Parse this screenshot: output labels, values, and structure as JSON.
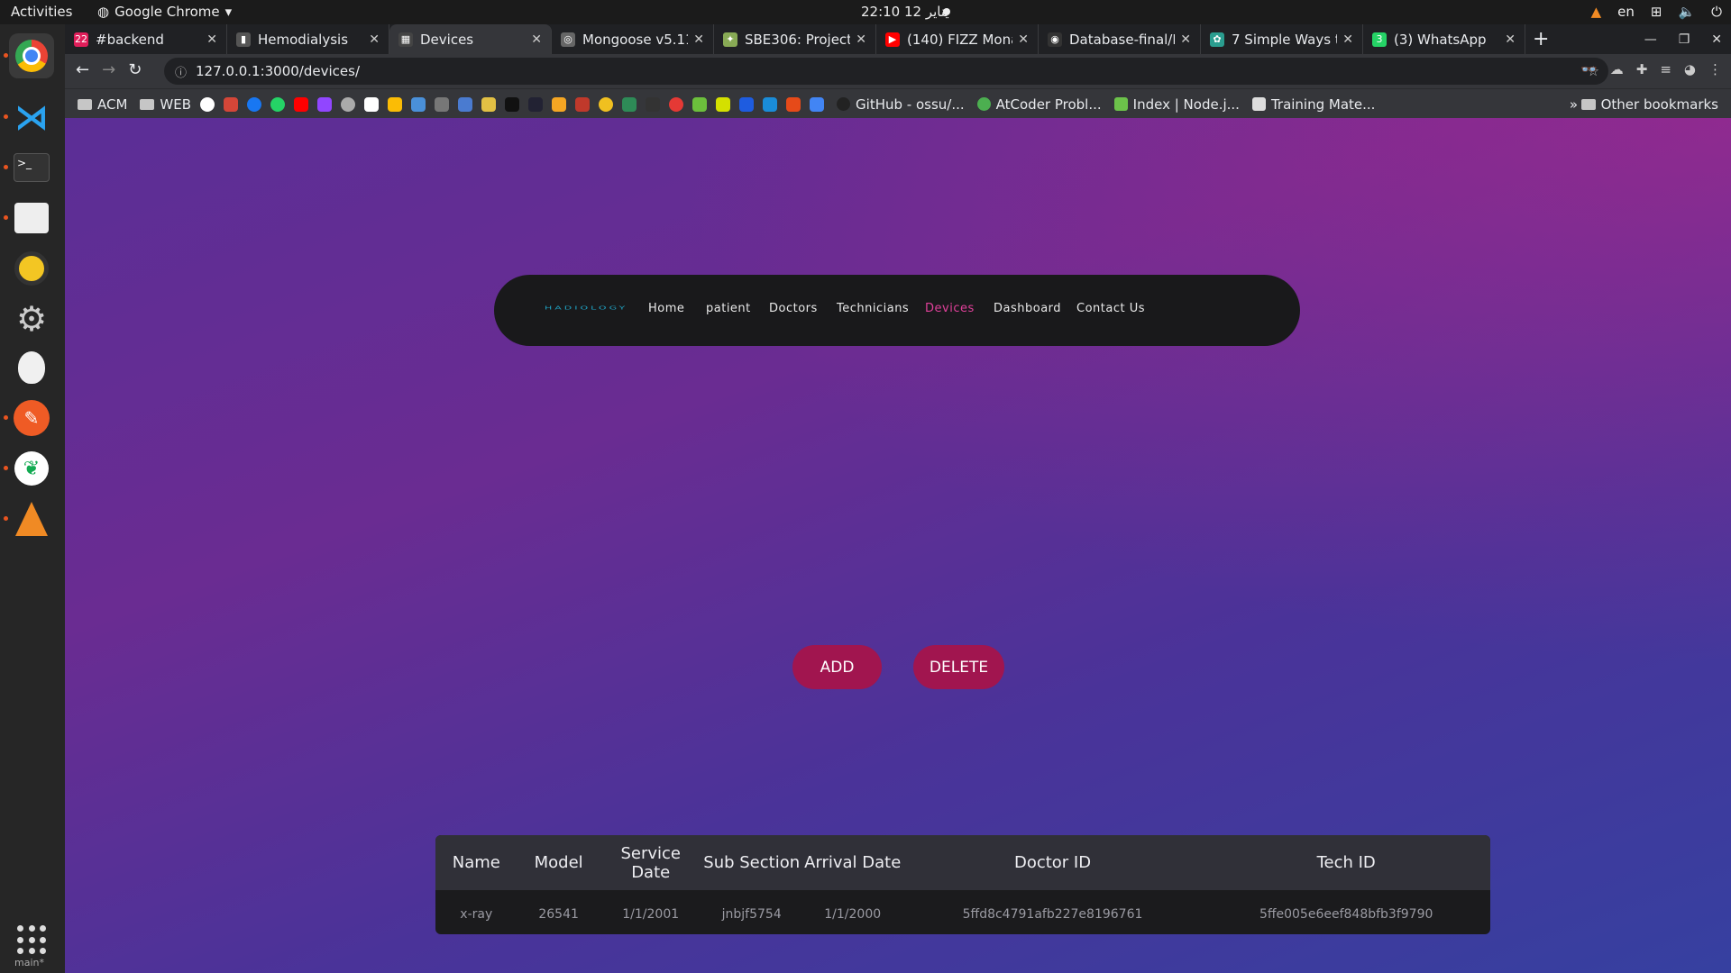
{
  "system": {
    "activities": "Activities",
    "app_name": "Google Chrome",
    "clock": "22:10  12 يناير",
    "lang": "en"
  },
  "tabs": [
    {
      "title": "#backend",
      "fav_color": "#e01e5a",
      "fav_glyph": "22"
    },
    {
      "title": "Hemodialysis",
      "fav_color": "#555",
      "fav_glyph": "▮"
    },
    {
      "title": "Devices",
      "fav_color": "#444",
      "fav_glyph": "▦",
      "active": true
    },
    {
      "title": "Mongoose v5.11.",
      "fav_color": "#666",
      "fav_glyph": "◎"
    },
    {
      "title": "SBE306: Project",
      "fav_color": "#8a5",
      "fav_glyph": "✦"
    },
    {
      "title": "(140) FIZZ Monast",
      "fav_color": "#ff0000",
      "fav_glyph": "▶"
    },
    {
      "title": "Database-final/D",
      "fav_color": "#333",
      "fav_glyph": "◉"
    },
    {
      "title": "7 Simple Ways to",
      "fav_color": "#2a9d8f",
      "fav_glyph": "✿"
    },
    {
      "title": "(3) WhatsApp",
      "fav_color": "#25d366",
      "fav_glyph": "3"
    }
  ],
  "omnibox": {
    "url": "127.0.0.1:3000/devices/"
  },
  "bookmarks": {
    "acm": "ACM",
    "web": "WEB",
    "github": "GitHub - ossu/...",
    "atcoder": "AtCoder Probl...",
    "node": "Index | Node.j...",
    "training": "Training Mate...",
    "more": "»",
    "other": "Other bookmarks"
  },
  "nav": {
    "logo": "HADIOLOGY",
    "items": [
      {
        "label": "Home"
      },
      {
        "label": "patient"
      },
      {
        "label": "Doctors"
      },
      {
        "label": "Technicians"
      },
      {
        "label": "Devices",
        "active": true
      },
      {
        "label": "Dashboard"
      },
      {
        "label": "Contact Us"
      }
    ]
  },
  "actions": {
    "add": "ADD",
    "delete": "DELETE"
  },
  "table": {
    "headers": [
      "Name",
      "Model",
      "Service Date",
      "Sub Section",
      "Arrival Date",
      "Doctor ID",
      "Tech ID"
    ],
    "rows": [
      [
        "x-ray",
        "26541",
        "1/1/2001",
        "jnbjf5754",
        "1/1/2000",
        "5ffd8c4791afb227e8196761",
        "5ffe005e6eef848bfb3f9790"
      ]
    ]
  },
  "dock": {
    "branch": "main*"
  },
  "colors": {
    "accent": "#a1154f",
    "nav_active": "#e0409a",
    "navbar_bg": "#19191b"
  }
}
